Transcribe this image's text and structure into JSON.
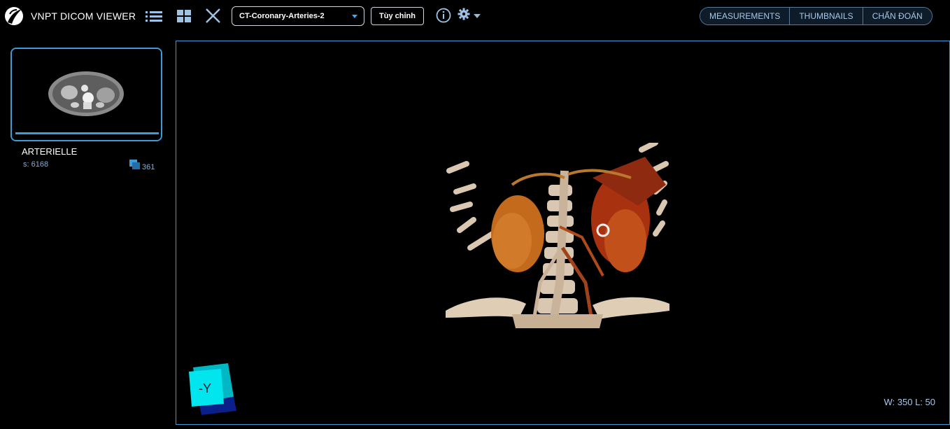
{
  "app": {
    "title": "VNPT DICOM VIEWER"
  },
  "toolbar": {
    "list_icon": "list-icon",
    "layout_icon": "grid-layout-icon",
    "close_icon": "close-icon",
    "protocol_value": "CT-Coronary-Arteries-2",
    "custom_label": "Tùy chỉnh",
    "info_icon": "info-icon",
    "settings_icon": "gear-icon"
  },
  "right_tabs": [
    {
      "label": "MEASUREMENTS"
    },
    {
      "label": "THUMBNAILS"
    },
    {
      "label": "CHẨN ĐOÁN"
    }
  ],
  "series": {
    "name": "ARTERIELLE",
    "number": "s: 6168",
    "image_count": "361"
  },
  "viewport": {
    "window_level": "W: 350 L: 50",
    "orientation_label": "-Y"
  },
  "colors": {
    "accent": "#3f9bd8",
    "tab_text": "#a9c8e6",
    "orientation_cube": "#00e5ee"
  }
}
